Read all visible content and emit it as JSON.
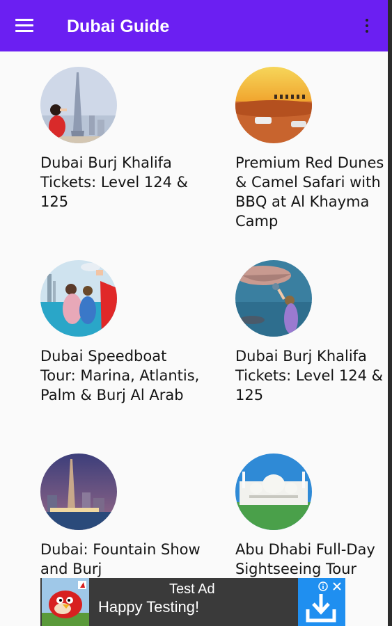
{
  "appbar": {
    "title": "Dubai Guide",
    "menu_icon": "hamburger-menu-icon",
    "overflow_icon": "more-vert-icon",
    "color": "#6b1ff2"
  },
  "tours": [
    {
      "title": "Dubai Burj Khalifa Tickets: Level 124 & 125"
    },
    {
      "title": "Premium Red Dunes & Camel Safari with BBQ at Al Khayma Camp"
    },
    {
      "title": "Dubai Speedboat Tour: Marina, Atlantis, Palm & Burj Al Arab"
    },
    {
      "title": "Dubai Burj Khalifa Tickets: Level 124 & 125"
    },
    {
      "title": "Dubai: Fountain Show and Burj"
    },
    {
      "title": "Abu Dhabi Full-Day Sightseeing Tour"
    }
  ],
  "ad": {
    "line1": "Test Ad",
    "line2": "Happy Testing!",
    "info_icon": "info-icon",
    "close_icon": "close-icon",
    "download_icon": "download-icon"
  }
}
